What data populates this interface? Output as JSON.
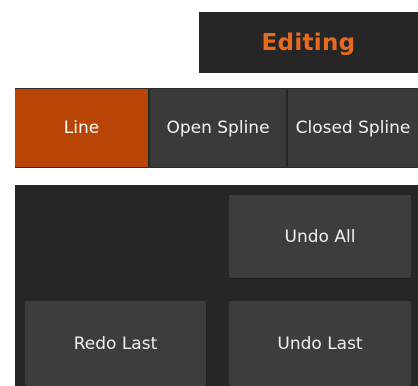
{
  "header": {
    "title": "Editing",
    "title_color": "#e86a1f",
    "background": "#262626"
  },
  "mode_selector": {
    "options": [
      {
        "label": "Line",
        "selected": true
      },
      {
        "label": "Open Spline",
        "selected": false
      },
      {
        "label": "Closed Spline",
        "selected": false
      }
    ],
    "active_color": "#b84506",
    "inactive_color": "#3a3a3a"
  },
  "actions": {
    "undo_all": "Undo All",
    "redo_last": "Redo Last",
    "undo_last": "Undo Last",
    "panel_color": "#262626",
    "button_color": "#3d3d3d"
  }
}
